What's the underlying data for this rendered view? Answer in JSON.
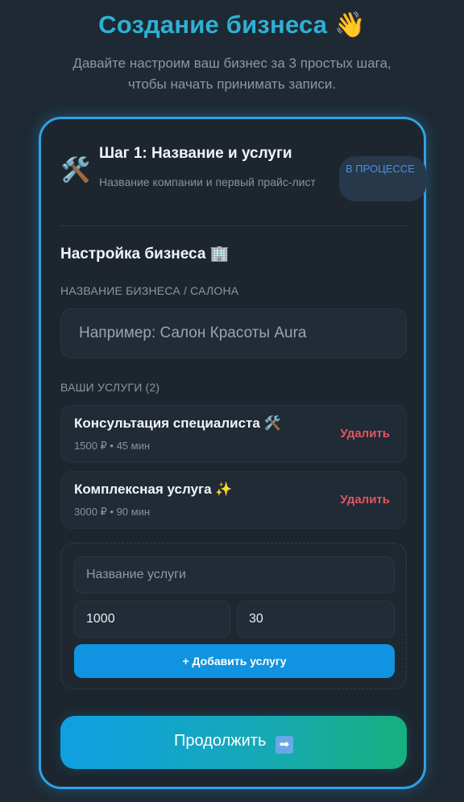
{
  "header": {
    "title": "Создание бизнеса",
    "title_emoji": "👋",
    "subtitle_line1": "Давайте настроим ваш бизнес за 3 простых шага,",
    "subtitle_line2": "чтобы начать принимать записи."
  },
  "step": {
    "icon": "🛠️",
    "title": "Шаг 1: Название и услуги",
    "description": "Название компании и первый прайс-лист",
    "status": "В процессе"
  },
  "business": {
    "section_title": "Настройка бизнеса 🏢",
    "name_label": "НАЗВАНИЕ БИЗНЕСА / САЛОНА",
    "name_value": "",
    "name_placeholder": "Например: Салон Красоты Aura"
  },
  "services": {
    "label": "ВАШИ УСЛУГИ (2)",
    "items": [
      {
        "name": "Консультация специалиста 🛠️",
        "meta": "1500 ₽ • 45 мин",
        "delete_label": "Удалить"
      },
      {
        "name": "Комплексная услуга ✨",
        "meta": "3000 ₽ • 90 мин",
        "delete_label": "Удалить"
      }
    ]
  },
  "new_service": {
    "name_placeholder": "Название услуги",
    "name_value": "",
    "price_value": "1000",
    "duration_value": "30",
    "add_label": "+ Добавить услугу"
  },
  "continue": {
    "label": "Продолжить",
    "arrow": "➡"
  },
  "colors": {
    "accent": "#2ea2e6",
    "title": "#2eb0d4",
    "danger": "#e25560",
    "background": "#1e2933"
  }
}
